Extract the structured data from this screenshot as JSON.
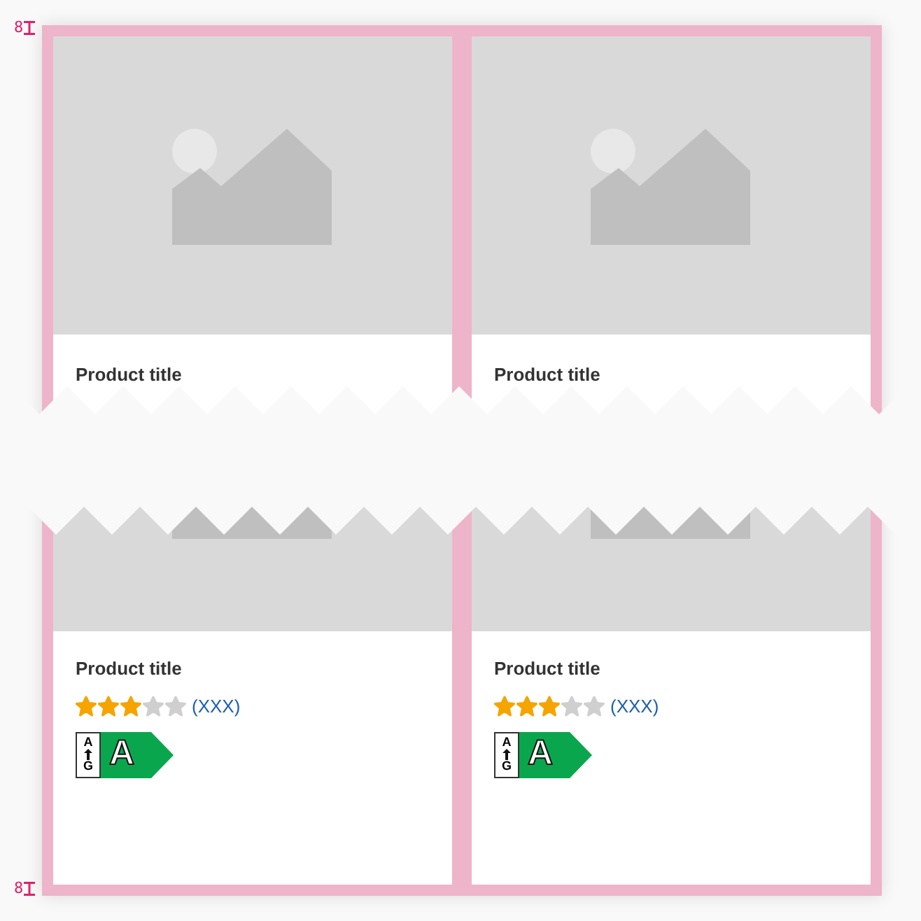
{
  "spacing_marks": [
    {
      "value": "8"
    },
    {
      "value": "8"
    }
  ],
  "upper_row": [
    {
      "title": "Product title"
    },
    {
      "title": "Product title"
    }
  ],
  "lower_row": [
    {
      "title": "Product title",
      "stars": 3,
      "count": "(XXX)",
      "energy_scale_top": "A",
      "energy_scale_bottom": "G",
      "energy_class": "A"
    },
    {
      "title": "Product title",
      "stars": 3,
      "count": "(XXX)",
      "energy_scale_top": "A",
      "energy_scale_bottom": "G",
      "energy_class": "A"
    }
  ]
}
